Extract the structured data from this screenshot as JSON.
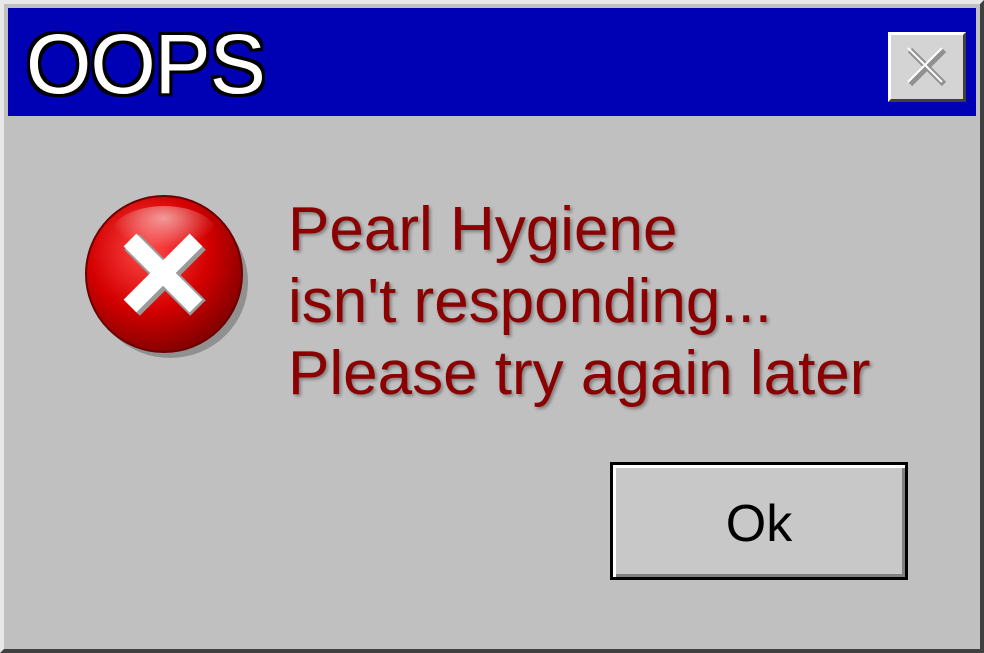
{
  "window": {
    "title": "OOPS",
    "close_icon": "close-icon"
  },
  "dialog": {
    "icon": "error-icon",
    "message_lines": [
      "Pearl Hygiene",
      "isn't responding...",
      "Please try again later"
    ],
    "ok_label": "Ok"
  },
  "colors": {
    "titlebar": "#0000b4",
    "message_text": "#8b0000",
    "window_bg": "#c0c0c0"
  }
}
